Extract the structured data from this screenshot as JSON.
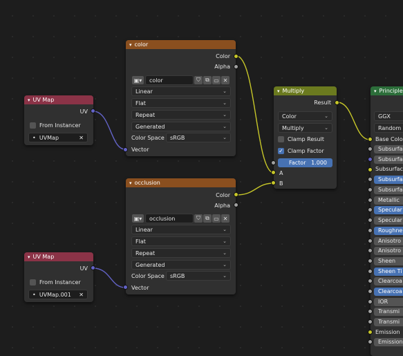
{
  "uvmap1": {
    "title": "UV Map",
    "out": "UV",
    "from_instancer": "From Instancer",
    "uvmap": "UVMap"
  },
  "uvmap2": {
    "title": "UV Map",
    "out": "UV",
    "from_instancer": "From Instancer",
    "uvmap": "UVMap.001"
  },
  "color_tex": {
    "title": "color",
    "out_color": "Color",
    "out_alpha": "Alpha",
    "image_name": "color",
    "interpolation": "Linear",
    "projection": "Flat",
    "extension": "Repeat",
    "source": "Generated",
    "color_space_label": "Color Space",
    "color_space": "sRGB",
    "vector": "Vector"
  },
  "occ_tex": {
    "title": "occlusion",
    "out_color": "Color",
    "out_alpha": "Alpha",
    "image_name": "occlusion",
    "interpolation": "Linear",
    "projection": "Flat",
    "extension": "Repeat",
    "source": "Generated",
    "color_space_label": "Color Space",
    "color_space": "sRGB",
    "vector": "Vector"
  },
  "multiply": {
    "title": "Multiply",
    "result": "Result",
    "type": "Color",
    "blend": "Multiply",
    "clamp_result": "Clamp Result",
    "clamp_factor": "Clamp Factor",
    "factor_label": "Factor",
    "factor_value": "1.000",
    "in_a": "A",
    "in_b": "B"
  },
  "principled": {
    "title": "Principle",
    "distribution": "GGX",
    "sss_method": "Random W",
    "base_color": "Base Color",
    "inputs": [
      "Subsurfa",
      "Subsurfac",
      "Subsurface",
      "Subsurfa",
      "Subsurfa",
      "Metallic",
      "Specular",
      "Specular",
      "Roughne",
      "Anisotro",
      "Anisotro",
      "Sheen",
      "Sheen Ti",
      "Clearcoa",
      "Clearcoa",
      "IOR",
      "Transmi",
      "Transmi",
      "Emission",
      "Emission"
    ]
  },
  "colors": {
    "texture_header": "#8a4f1f",
    "uv_header": "#8b3347",
    "converter_header": "#6b7a1f",
    "shader_header": "#2c6e3a",
    "wire_color": "#c7c729",
    "wire_vector": "#6363c7"
  }
}
